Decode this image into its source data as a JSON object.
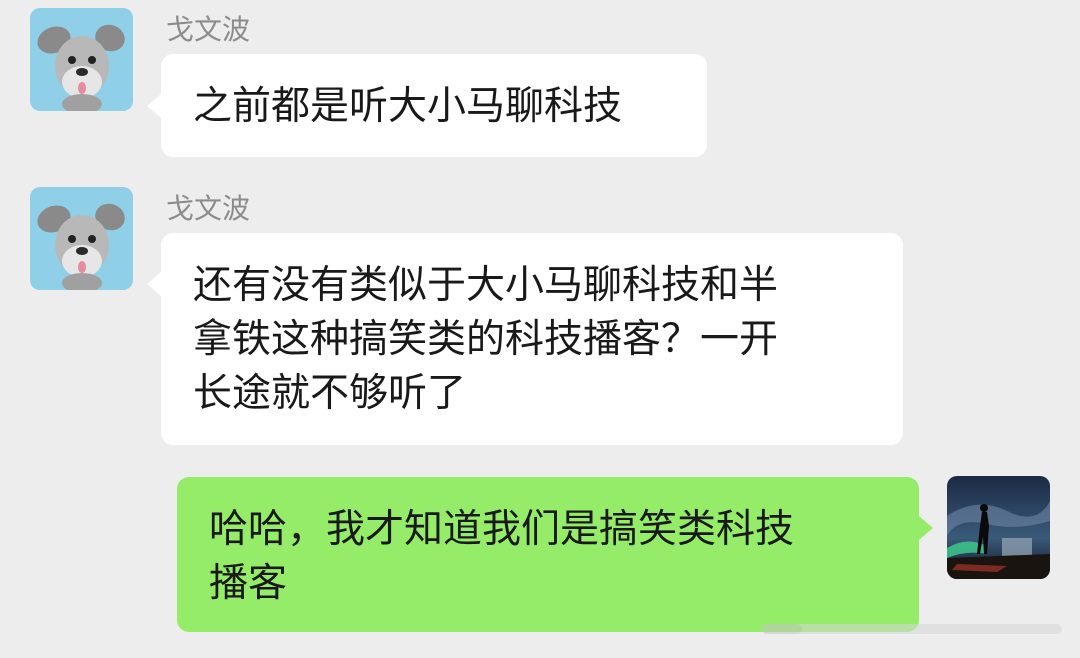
{
  "messages": [
    {
      "direction": "incoming",
      "sender": "戈文波",
      "avatar": "schnauzer-dog-avatar",
      "text": "之前都是听大小马聊科技"
    },
    {
      "direction": "incoming",
      "sender": "戈文波",
      "avatar": "schnauzer-dog-avatar",
      "lines": [
        "还有没有类似于大小马聊科技和半",
        "拿铁这种搞笑类的科技播客？一开",
        "长途就不够听了"
      ]
    },
    {
      "direction": "outgoing",
      "avatar": "aurora-night-avatar",
      "lines": [
        "哈哈，我才知道我们是搞笑类科技",
        "播客"
      ]
    }
  ],
  "colors": {
    "background": "#ededed",
    "incoming_bubble": "#ffffff",
    "outgoing_bubble": "#95ec69",
    "sender_name": "#8c8c8c",
    "text": "#191919"
  }
}
